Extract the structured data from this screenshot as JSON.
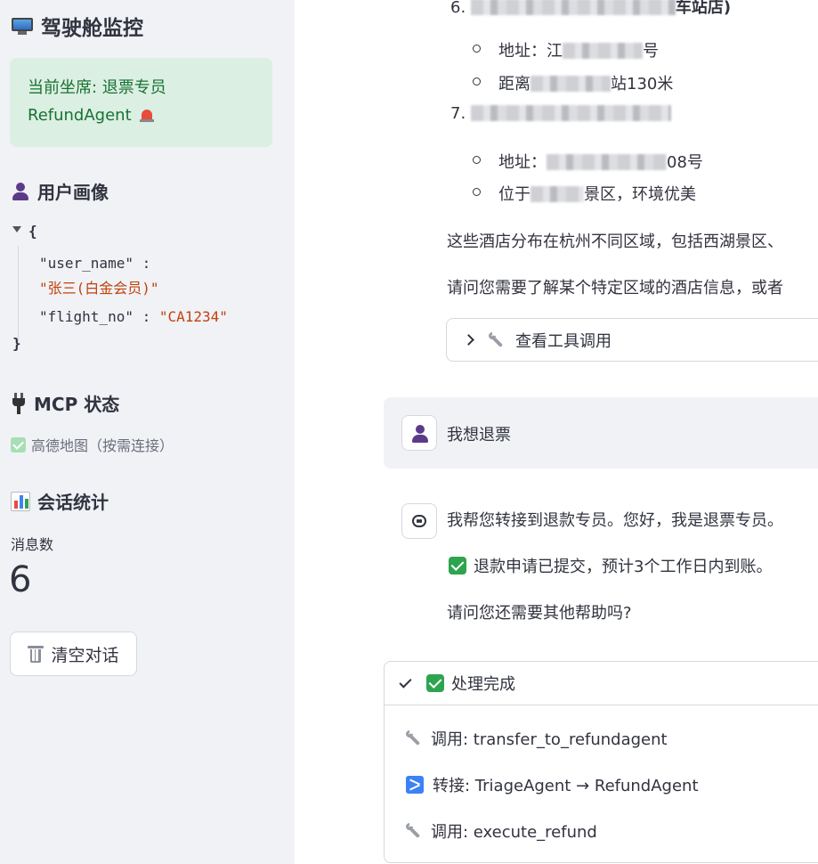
{
  "sidebar": {
    "title": "驾驶舱监控",
    "seat_label": "当前坐席: 退票专员",
    "seat_agent": "RefundAgent",
    "profile_heading": "用户画像",
    "profile": {
      "open_brace": "{",
      "close_brace": "}",
      "entries": [
        {
          "key": "\"user_name\"",
          "sep": " :",
          "value": "\"张三(白金会员)\""
        },
        {
          "key": "\"flight_no\"",
          "sep": " :",
          "value": "\"CA1234\""
        }
      ]
    },
    "mcp_heading": "MCP 状态",
    "mcp_status": "高德地图（按需连接）",
    "stats_heading": "会话统计",
    "metric_label": "消息数",
    "metric_value": "6",
    "clear_button": "清空对话"
  },
  "chat": {
    "hotel_list": [
      {
        "number": "6.",
        "visible_tail": "车站店)"
      },
      {
        "address_prefix": "地址：江",
        "address_suffix": "号"
      },
      {
        "distance_prefix": "距离",
        "distance_suffix": "站130米"
      },
      {
        "number": "7."
      },
      {
        "address_prefix": "地址：",
        "address_suffix": "08号"
      },
      {
        "location_prefix": "位于",
        "location_suffix": "景区，环境优美"
      }
    ],
    "summary_line": "这些酒店分布在杭州不同区域，包括西湖景区、",
    "question_line": "请问您需要了解某个特定区域的酒店信息，或者",
    "tool_expander": "查看工具调用",
    "user_message": "我想退票",
    "assistant_reply": "我帮您转接到退款专员。您好，我是退票专员。",
    "refund_confirm": "退款申请已提交，预计3个工作日内到账。",
    "followup": "请问您还需要其他帮助吗?"
  },
  "status_panel": {
    "title": "处理完成",
    "items": [
      {
        "icon": "wrench-icon",
        "text": "调用: transfer_to_refundagent"
      },
      {
        "icon": "shuffle-icon",
        "text": "转接: TriageAgent → RefundAgent"
      },
      {
        "icon": "wrench-icon",
        "text": "调用: execute_refund"
      }
    ]
  },
  "colors": {
    "sidebar_bg": "#f0f2f6",
    "success_bg": "#dcefe3",
    "success_text": "#177233",
    "json_string": "#c2410c",
    "check_green": "#2ea44f"
  }
}
